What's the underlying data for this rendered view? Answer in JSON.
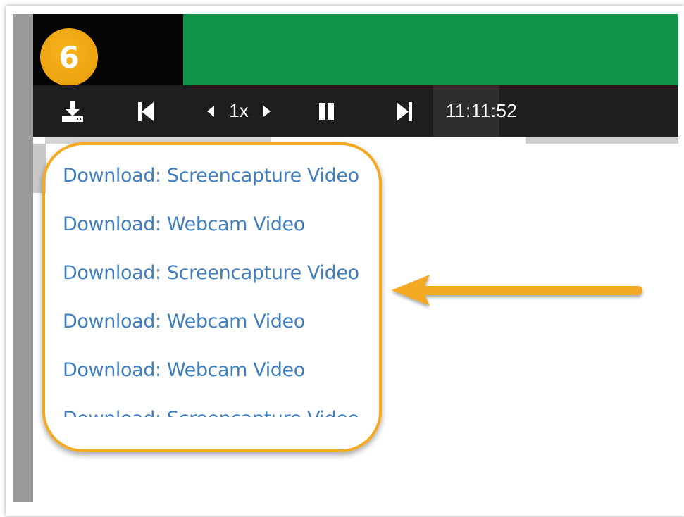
{
  "step_badge": "6",
  "player": {
    "speed": "1x",
    "time": "11:11:52"
  },
  "links": [
    "Download: Screencapture Video",
    "Download: Webcam Video",
    "Download: Screencapture Video",
    "Download: Webcam Video",
    "Download: Webcam Video",
    "Download: Screencapture Video"
  ],
  "colors": {
    "accent": "#f4a922",
    "video_green": "#0e9349",
    "link": "#3f7ebf",
    "control_bar": "#1e1e1e"
  },
  "icons": [
    "download-icon",
    "skip-back-icon",
    "speed-down-icon",
    "speed-up-icon",
    "pause-icon",
    "skip-forward-icon",
    "arrow-left-annotation"
  ]
}
